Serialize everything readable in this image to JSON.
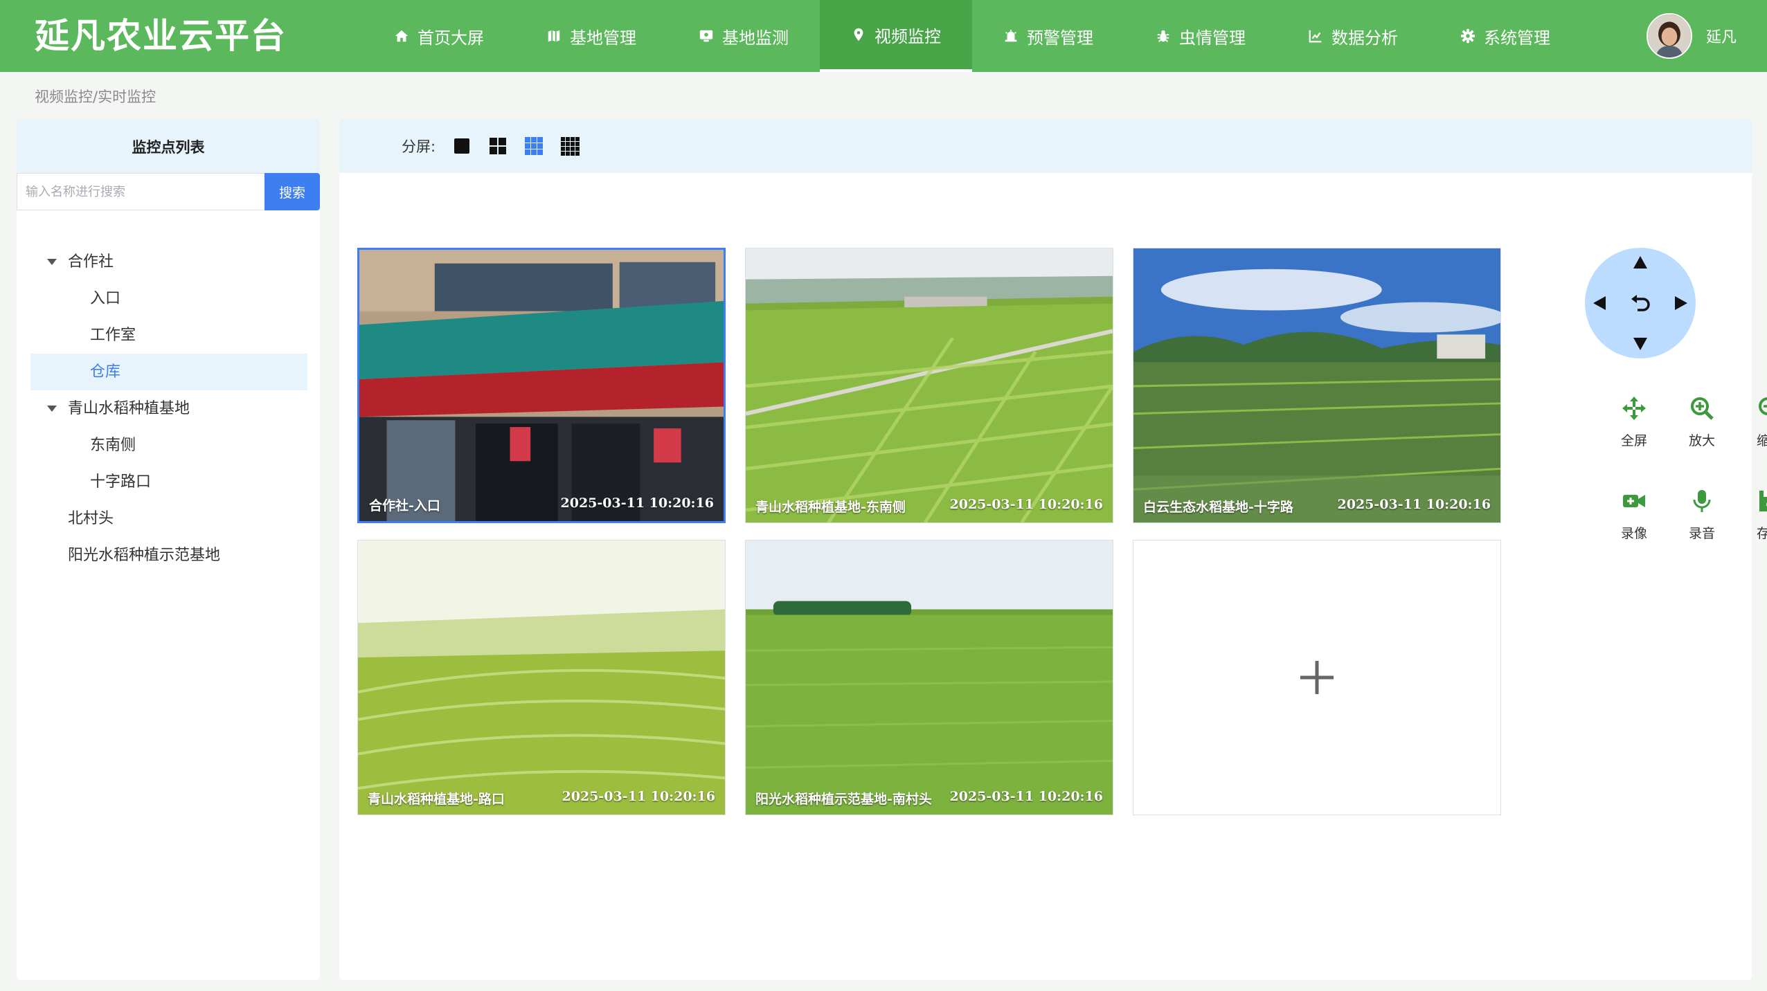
{
  "app": {
    "title": "延凡农业云平台"
  },
  "nav": {
    "items": [
      {
        "label": "首页大屏",
        "icon": "home-icon"
      },
      {
        "label": "基地管理",
        "icon": "map-icon"
      },
      {
        "label": "基地监测",
        "icon": "monitor-icon"
      },
      {
        "label": "视频监控",
        "icon": "location-pin-icon",
        "active": true
      },
      {
        "label": "预警管理",
        "icon": "alarm-icon"
      },
      {
        "label": "虫情管理",
        "icon": "bug-icon"
      },
      {
        "label": "数据分析",
        "icon": "chart-icon"
      },
      {
        "label": "系统管理",
        "icon": "gear-icon"
      }
    ]
  },
  "user": {
    "name": "延凡"
  },
  "breadcrumb": "视频监控/实时监控",
  "sidebar": {
    "title": "监控点列表",
    "search": {
      "placeholder": "输入名称进行搜索",
      "button": "搜索"
    },
    "tree": [
      {
        "label": "合作社",
        "level": 1,
        "expanded": true
      },
      {
        "label": "入口",
        "level": 2
      },
      {
        "label": "工作室",
        "level": 2
      },
      {
        "label": "仓库",
        "level": 2,
        "selected": true
      },
      {
        "label": "青山水稻种植基地",
        "level": 1,
        "expanded": true
      },
      {
        "label": "东南侧",
        "level": 2
      },
      {
        "label": "十字路口",
        "level": 2
      },
      {
        "label": "北村头",
        "level": 1
      },
      {
        "label": "阳光水稻种植示范基地",
        "level": 1
      }
    ]
  },
  "split": {
    "label": "分屏:",
    "options": [
      "1",
      "4",
      "9",
      "16"
    ],
    "selected": "9"
  },
  "cameras": [
    {
      "name": "合作社-入口",
      "time": "2025-03-11 10:20:16",
      "active": true
    },
    {
      "name": "青山水稻种植基地-东南侧",
      "time": "2025-03-11 10:20:16"
    },
    {
      "name": "白云生态水稻基地-十字路",
      "time": "2025-03-11 10:20:16"
    },
    {
      "name": "青山水稻种植基地-路口",
      "time": "2025-03-11 10:20:16"
    },
    {
      "name": "阳光水稻种植示范基地-南村头",
      "time": "2025-03-11 10:20:16"
    }
  ],
  "controls": {
    "ptz": [
      "up",
      "down",
      "left",
      "right",
      "reset"
    ],
    "buttons": [
      {
        "label": "全屏",
        "icon": "move-icon"
      },
      {
        "label": "放大",
        "icon": "zoom-in-icon"
      },
      {
        "label": "缩小",
        "icon": "zoom-out-icon"
      },
      {
        "label": "录像",
        "icon": "video-camera-icon"
      },
      {
        "label": "录音",
        "icon": "microphone-icon"
      },
      {
        "label": "存储",
        "icon": "save-icon"
      }
    ]
  },
  "colors": {
    "header": "#5cb85c",
    "accent": "#3d7ef0",
    "control_green": "#3c9a3c"
  }
}
